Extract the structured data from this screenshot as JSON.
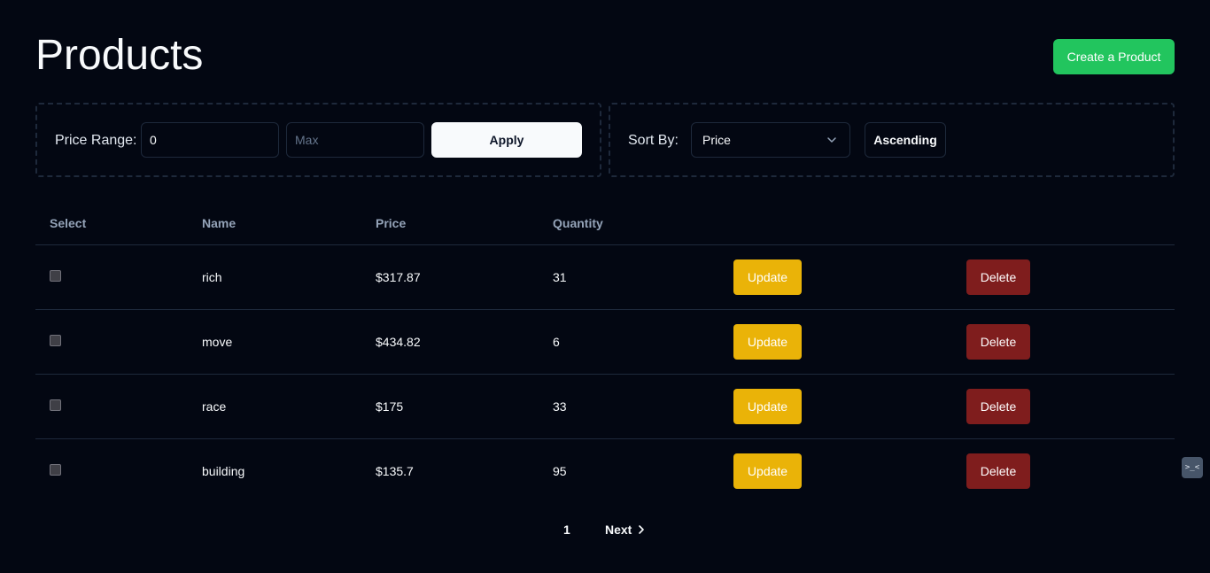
{
  "header": {
    "title": "Products",
    "create_label": "Create a Product"
  },
  "filters": {
    "price_label": "Price Range:",
    "min_value": "0",
    "max_placeholder": "Max",
    "apply_label": "Apply",
    "sort_label": "Sort By:",
    "sort_selected": "Price",
    "order_label": "Ascending"
  },
  "table": {
    "headers": [
      "Select",
      "Name",
      "Price",
      "Quantity"
    ],
    "rows": [
      {
        "name": "rich",
        "price": "$317.87",
        "quantity": "31"
      },
      {
        "name": "move",
        "price": "$434.82",
        "quantity": "6"
      },
      {
        "name": "race",
        "price": "$175",
        "quantity": "33"
      },
      {
        "name": "building",
        "price": "$135.7",
        "quantity": "95"
      }
    ],
    "update_label": "Update",
    "delete_label": "Delete"
  },
  "pagination": {
    "current_page": "1",
    "next_label": "Next"
  },
  "colors": {
    "background": "#030712",
    "create": "#22c55e",
    "update": "#eab308",
    "delete": "#7f1d1d"
  },
  "widget": {
    "glyph": ">_<"
  }
}
